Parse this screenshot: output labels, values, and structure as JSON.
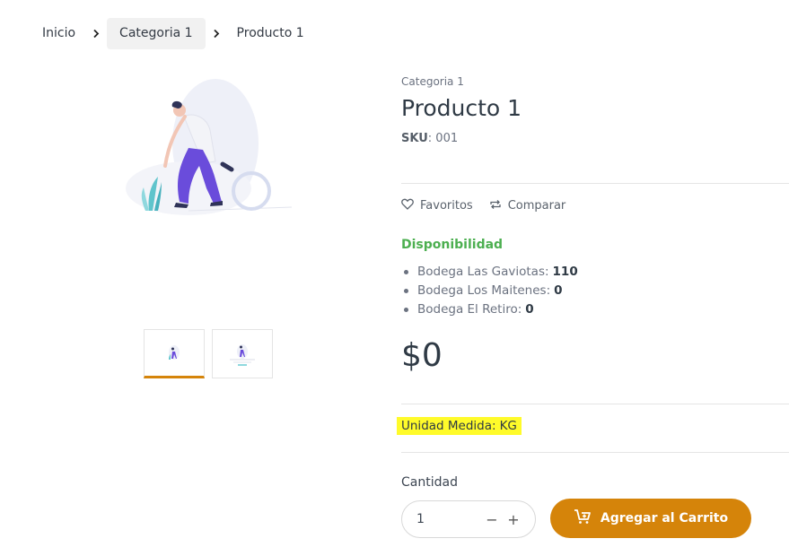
{
  "breadcrumb": {
    "items": [
      {
        "label": "Inicio"
      },
      {
        "label": "Categoria 1"
      },
      {
        "label": "Producto 1"
      }
    ],
    "separator_icon": "chevron-right-icon"
  },
  "gallery": {
    "main_image": "person-with-magnifier-illustration",
    "thumbnails": 2,
    "active_thumbnail": 1,
    "accent": "#d5840a"
  },
  "product": {
    "category": "Categoria 1",
    "title": "Producto 1",
    "sku_label": "SKU",
    "sku_sep": ":",
    "sku_value": "001",
    "actions": {
      "favorites": "Favoritos",
      "compare": "Comparar"
    },
    "availability": {
      "title": "Disponibilidad",
      "color": "#4caf50",
      "stores": [
        {
          "name": "Bodega Las Gaviotas:",
          "qty": "110"
        },
        {
          "name": "Bodega Los Maitenes:",
          "qty": "0"
        },
        {
          "name": "Bodega El Retiro:",
          "qty": "0"
        }
      ]
    },
    "price": "$0",
    "unit": {
      "label": "Unidad Medida:",
      "value": "KG",
      "highlight": "#fffb2a"
    }
  },
  "cart": {
    "qty_label": "Cantidad",
    "qty_value": "1",
    "minus": "−",
    "plus": "+",
    "add_label": "Agregar al Carrito",
    "button_color": "#d5840a"
  }
}
